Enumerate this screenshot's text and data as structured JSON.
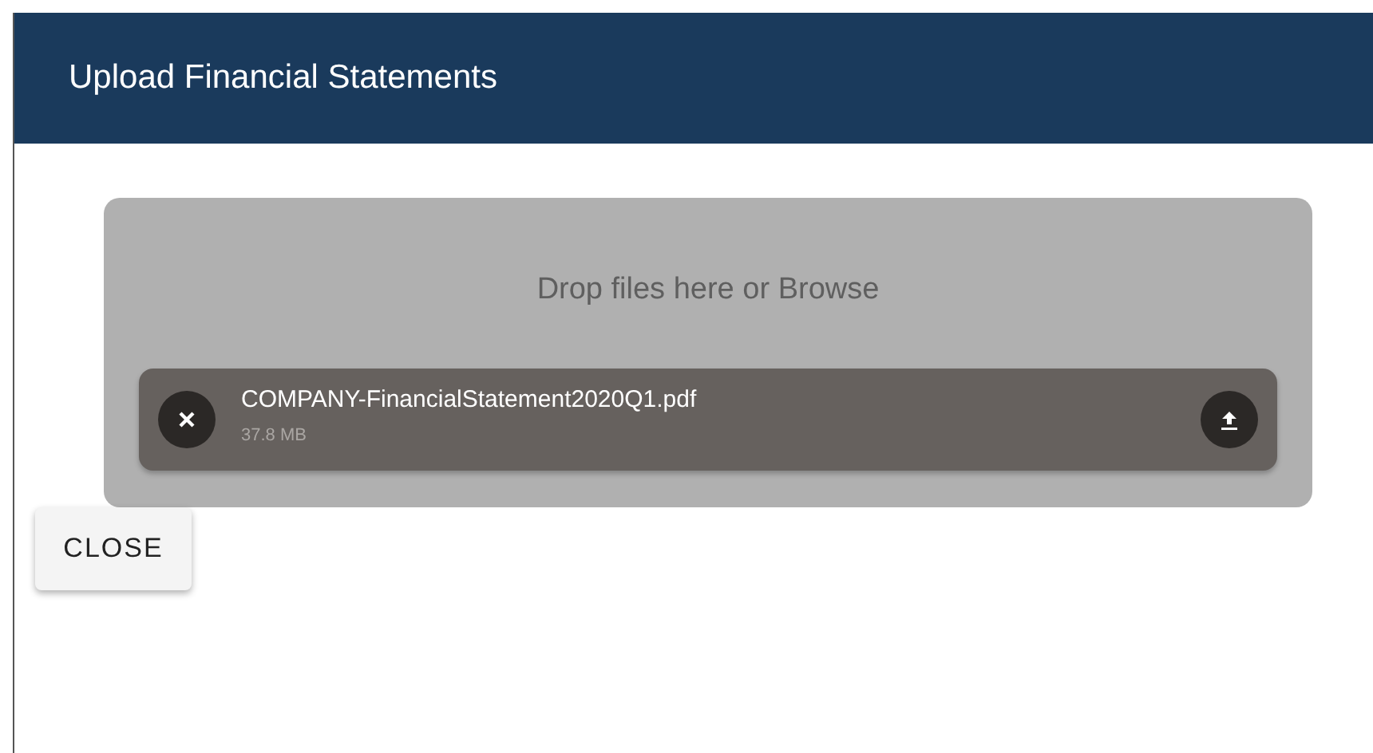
{
  "dialog": {
    "title": "Upload Financial Statements"
  },
  "dropzone": {
    "prompt": "Drop files here or Browse"
  },
  "files": [
    {
      "name": "COMPANY-FinancialStatement2020Q1.pdf",
      "size": "37.8 MB"
    }
  ],
  "buttons": [
    {
      "label": "CLOSE"
    }
  ]
}
